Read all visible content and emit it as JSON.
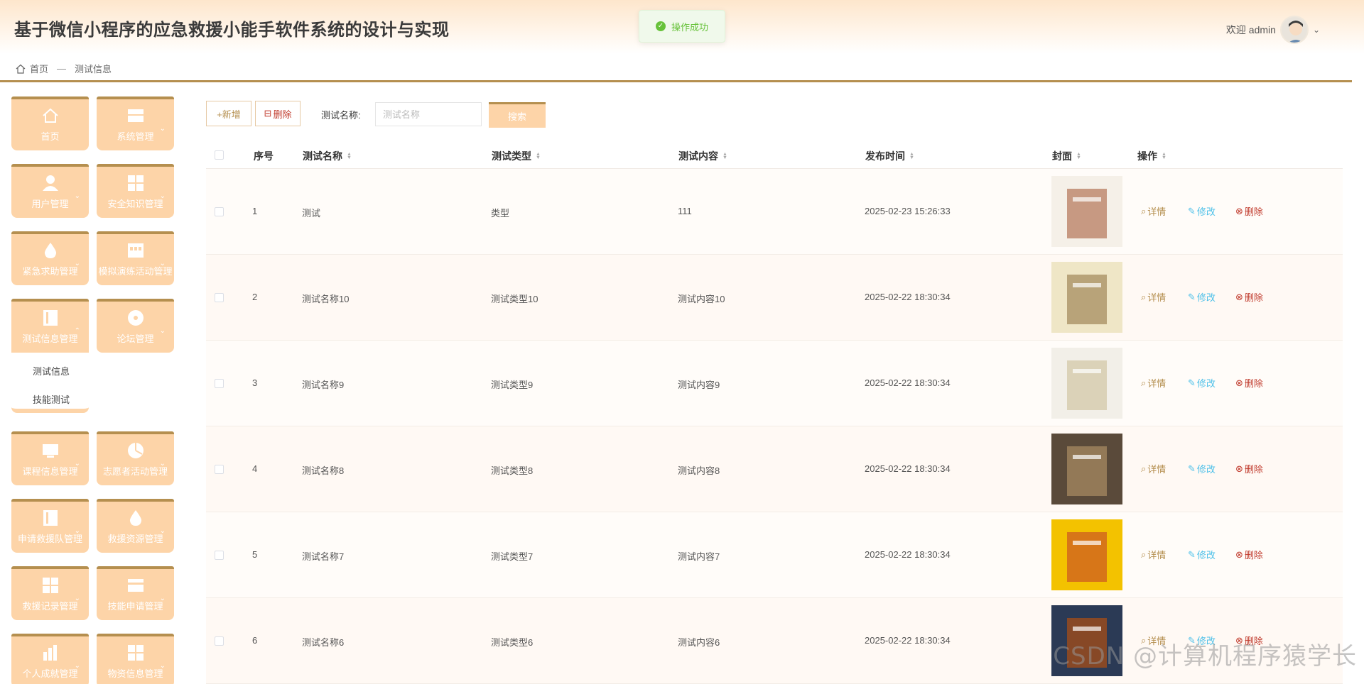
{
  "header": {
    "title": "基于微信小程序的应急救援小能手软件系统的设计与实现",
    "welcome": "欢迎 admin",
    "toast": "操作成功"
  },
  "breadcrumb": {
    "home": "首页",
    "separator": "—",
    "current": "测试信息"
  },
  "sidebar": {
    "items": [
      {
        "label": "首页",
        "icon": "home-icon"
      },
      {
        "label": "系统管理",
        "icon": "window-icon"
      },
      {
        "label": "用户管理",
        "icon": "user-icon"
      },
      {
        "label": "安全知识管理",
        "icon": "grid-icon"
      },
      {
        "label": "紧急求助管理",
        "icon": "drop-icon"
      },
      {
        "label": "模拟演练活动管理",
        "icon": "store-icon"
      },
      {
        "label": "测试信息管理",
        "icon": "book-icon"
      },
      {
        "label": "论坛管理",
        "icon": "disc-icon"
      },
      {
        "label": "课程信息管理",
        "icon": "monitor-icon"
      },
      {
        "label": "志愿者活动管理",
        "icon": "pie-icon"
      },
      {
        "label": "申请救援队管理",
        "icon": "book-icon"
      },
      {
        "label": "救援资源管理",
        "icon": "drop-icon"
      },
      {
        "label": "救援记录管理",
        "icon": "grid-icon"
      },
      {
        "label": "技能申请管理",
        "icon": "card-icon"
      },
      {
        "label": "个人成就管理",
        "icon": "chart-icon"
      },
      {
        "label": "物资信息管理",
        "icon": "grid-icon"
      }
    ],
    "submenu": [
      "测试信息",
      "技能测试"
    ]
  },
  "toolbar": {
    "add_label": "+新增",
    "delete_label": "删除",
    "search_label": "测试名称:",
    "search_placeholder": "测试名称",
    "search_button": "搜索"
  },
  "table": {
    "headers": [
      "序号",
      "测试名称",
      "测试类型",
      "测试内容",
      "发布时间",
      "封面",
      "操作"
    ],
    "actions": {
      "detail": "详情",
      "edit": "修改",
      "delete": "删除"
    },
    "rows": [
      {
        "index": "1",
        "name": "测试",
        "type": "类型",
        "content": "111",
        "time": "2025-02-23 15:26:33"
      },
      {
        "index": "2",
        "name": "测试名称10",
        "type": "测试类型10",
        "content": "测试内容10",
        "time": "2025-02-22 18:30:34"
      },
      {
        "index": "3",
        "name": "测试名称9",
        "type": "测试类型9",
        "content": "测试内容9",
        "time": "2025-02-22 18:30:34"
      },
      {
        "index": "4",
        "name": "测试名称8",
        "type": "测试类型8",
        "content": "测试内容8",
        "time": "2025-02-22 18:30:34"
      },
      {
        "index": "5",
        "name": "测试名称7",
        "type": "测试类型7",
        "content": "测试内容7",
        "time": "2025-02-22 18:30:34"
      },
      {
        "index": "6",
        "name": "测试名称6",
        "type": "测试类型6",
        "content": "测试内容6",
        "time": "2025-02-22 18:30:34"
      }
    ]
  },
  "watermark": "CSDN @计算机程序猿学长",
  "colors": {
    "accent": "#b58f4f",
    "menu_bg": "#fdd4a8",
    "success": "#67c23a",
    "edit": "#4fc1e9",
    "danger": "#c0392b"
  }
}
